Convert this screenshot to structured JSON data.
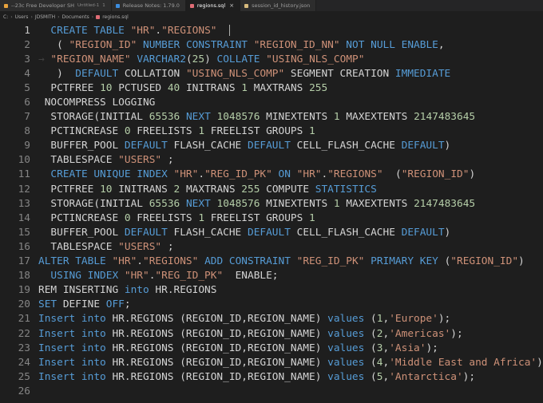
{
  "tabs": [
    {
      "label": "--23c Free Developer SH",
      "sub": "Untitled-1",
      "badge": "1",
      "color": "#e8a33d",
      "active": false
    },
    {
      "label": "Release Notes: 1.79.0",
      "sub": "",
      "badge": "",
      "color": "#3c8dde",
      "active": false
    },
    {
      "label": "regions.sql",
      "sub": "",
      "badge": "",
      "color": "#e06c75",
      "active": true,
      "close": "×"
    },
    {
      "label": "session_id_history.json",
      "sub": "",
      "badge": "",
      "color": "#d7ba7d",
      "active": false
    }
  ],
  "breadcrumb": [
    "C:",
    "Users",
    "JDSMITH",
    "Documents",
    "regions.sql"
  ],
  "lines": [
    {
      "n": "1",
      "t": [
        [
          "ind",
          "  "
        ],
        [
          "kw",
          "CREATE TABLE "
        ],
        [
          "str",
          "\"HR\""
        ],
        [
          "plain",
          "."
        ],
        [
          "str",
          "\"REGIONS\""
        ],
        [
          "plain",
          "  "
        ]
      ]
    },
    {
      "n": "2",
      "t": [
        [
          "ind",
          "   "
        ],
        [
          "plain",
          "( "
        ],
        [
          "str",
          "\"REGION_ID\""
        ],
        [
          "plain",
          " "
        ],
        [
          "kw",
          "NUMBER CONSTRAINT "
        ],
        [
          "str",
          "\"REGION_ID_NN\""
        ],
        [
          "plain",
          " "
        ],
        [
          "kw",
          "NOT NULL ENABLE"
        ],
        [
          "plain",
          ","
        ]
      ]
    },
    {
      "n": "3",
      "t": [
        [
          "ind",
          "→ "
        ],
        [
          "str",
          "\"REGION_NAME\""
        ],
        [
          "plain",
          " "
        ],
        [
          "kw",
          "VARCHAR2"
        ],
        [
          "plain",
          "("
        ],
        [
          "num",
          "25"
        ],
        [
          "plain",
          ") "
        ],
        [
          "kw",
          "COLLATE "
        ],
        [
          "str",
          "\"USING_NLS_COMP\""
        ]
      ]
    },
    {
      "n": "4",
      "t": [
        [
          "ind",
          "   "
        ],
        [
          "plain",
          ")  "
        ],
        [
          "kw",
          "DEFAULT "
        ],
        [
          "plain",
          "COLLATION "
        ],
        [
          "str",
          "\"USING_NLS_COMP\""
        ],
        [
          "plain",
          " SEGMENT CREATION "
        ],
        [
          "kw",
          "IMMEDIATE"
        ]
      ]
    },
    {
      "n": "5",
      "t": [
        [
          "ind",
          "  "
        ],
        [
          "plain",
          "PCTFREE "
        ],
        [
          "num",
          "10"
        ],
        [
          "plain",
          " PCTUSED "
        ],
        [
          "num",
          "40"
        ],
        [
          "plain",
          " INITRANS "
        ],
        [
          "num",
          "1"
        ],
        [
          "plain",
          " MAXTRANS "
        ],
        [
          "num",
          "255"
        ]
      ]
    },
    {
      "n": "6",
      "t": [
        [
          "plain",
          " NOCOMPRESS LOGGING"
        ]
      ]
    },
    {
      "n": "7",
      "t": [
        [
          "ind",
          "  "
        ],
        [
          "plain",
          "STORAGE(INITIAL "
        ],
        [
          "num",
          "65536"
        ],
        [
          "plain",
          " "
        ],
        [
          "kw",
          "NEXT"
        ],
        [
          "plain",
          " "
        ],
        [
          "num",
          "1048576"
        ],
        [
          "plain",
          " MINEXTENTS "
        ],
        [
          "num",
          "1"
        ],
        [
          "plain",
          " MAXEXTENTS "
        ],
        [
          "num",
          "2147483645"
        ]
      ]
    },
    {
      "n": "8",
      "t": [
        [
          "ind",
          "  "
        ],
        [
          "plain",
          "PCTINCREASE "
        ],
        [
          "num",
          "0"
        ],
        [
          "plain",
          " FREELISTS "
        ],
        [
          "num",
          "1"
        ],
        [
          "plain",
          " FREELIST GROUPS "
        ],
        [
          "num",
          "1"
        ]
      ]
    },
    {
      "n": "9",
      "t": [
        [
          "ind",
          "  "
        ],
        [
          "plain",
          "BUFFER_POOL "
        ],
        [
          "kw",
          "DEFAULT"
        ],
        [
          "plain",
          " FLASH_CACHE "
        ],
        [
          "kw",
          "DEFAULT"
        ],
        [
          "plain",
          " CELL_FLASH_CACHE "
        ],
        [
          "kw",
          "DEFAULT"
        ],
        [
          "plain",
          ")"
        ]
      ]
    },
    {
      "n": "10",
      "t": [
        [
          "ind",
          "  "
        ],
        [
          "plain",
          "TABLESPACE "
        ],
        [
          "str",
          "\"USERS\""
        ],
        [
          "plain",
          " ;"
        ]
      ]
    },
    {
      "n": "11",
      "t": [
        [
          "ind",
          "  "
        ],
        [
          "kw",
          "CREATE UNIQUE INDEX "
        ],
        [
          "str",
          "\"HR\""
        ],
        [
          "plain",
          "."
        ],
        [
          "str",
          "\"REG_ID_PK\""
        ],
        [
          "plain",
          " "
        ],
        [
          "kw",
          "ON"
        ],
        [
          "plain",
          " "
        ],
        [
          "str",
          "\"HR\""
        ],
        [
          "plain",
          "."
        ],
        [
          "str",
          "\"REGIONS\""
        ],
        [
          "plain",
          "  ("
        ],
        [
          "str",
          "\"REGION_ID\""
        ],
        [
          "plain",
          ")"
        ]
      ]
    },
    {
      "n": "12",
      "t": [
        [
          "ind",
          "  "
        ],
        [
          "plain",
          "PCTFREE "
        ],
        [
          "num",
          "10"
        ],
        [
          "plain",
          " INITRANS "
        ],
        [
          "num",
          "2"
        ],
        [
          "plain",
          " MAXTRANS "
        ],
        [
          "num",
          "255"
        ],
        [
          "plain",
          " COMPUTE "
        ],
        [
          "kw",
          "STATISTICS"
        ]
      ]
    },
    {
      "n": "13",
      "t": [
        [
          "ind",
          "  "
        ],
        [
          "plain",
          "STORAGE(INITIAL "
        ],
        [
          "num",
          "65536"
        ],
        [
          "plain",
          " "
        ],
        [
          "kw",
          "NEXT"
        ],
        [
          "plain",
          " "
        ],
        [
          "num",
          "1048576"
        ],
        [
          "plain",
          " MINEXTENTS "
        ],
        [
          "num",
          "1"
        ],
        [
          "plain",
          " MAXEXTENTS "
        ],
        [
          "num",
          "2147483645"
        ]
      ]
    },
    {
      "n": "14",
      "t": [
        [
          "ind",
          "  "
        ],
        [
          "plain",
          "PCTINCREASE "
        ],
        [
          "num",
          "0"
        ],
        [
          "plain",
          " FREELISTS "
        ],
        [
          "num",
          "1"
        ],
        [
          "plain",
          " FREELIST GROUPS "
        ],
        [
          "num",
          "1"
        ]
      ]
    },
    {
      "n": "15",
      "t": [
        [
          "ind",
          "  "
        ],
        [
          "plain",
          "BUFFER_POOL "
        ],
        [
          "kw",
          "DEFAULT"
        ],
        [
          "plain",
          " FLASH_CACHE "
        ],
        [
          "kw",
          "DEFAULT"
        ],
        [
          "plain",
          " CELL_FLASH_CACHE "
        ],
        [
          "kw",
          "DEFAULT"
        ],
        [
          "plain",
          ")"
        ]
      ]
    },
    {
      "n": "16",
      "t": [
        [
          "ind",
          "  "
        ],
        [
          "plain",
          "TABLESPACE "
        ],
        [
          "str",
          "\"USERS\""
        ],
        [
          "plain",
          " ;"
        ]
      ]
    },
    {
      "n": "17",
      "t": [
        [
          "kw",
          "ALTER TABLE "
        ],
        [
          "str",
          "\"HR\""
        ],
        [
          "plain",
          "."
        ],
        [
          "str",
          "\"REGIONS\""
        ],
        [
          "plain",
          " "
        ],
        [
          "kw",
          "ADD CONSTRAINT "
        ],
        [
          "str",
          "\"REG_ID_PK\""
        ],
        [
          "plain",
          " "
        ],
        [
          "kw",
          "PRIMARY KEY "
        ],
        [
          "plain",
          "("
        ],
        [
          "str",
          "\"REGION_ID\""
        ],
        [
          "plain",
          ")"
        ]
      ]
    },
    {
      "n": "18",
      "t": [
        [
          "ind",
          "  "
        ],
        [
          "kw",
          "USING INDEX "
        ],
        [
          "str",
          "\"HR\""
        ],
        [
          "plain",
          "."
        ],
        [
          "str",
          "\"REG_ID_PK\""
        ],
        [
          "plain",
          "  ENABLE;"
        ]
      ]
    },
    {
      "n": "19",
      "t": [
        [
          "plain",
          "REM INSERTING "
        ],
        [
          "kw",
          "into"
        ],
        [
          "plain",
          " HR.REGIONS"
        ]
      ]
    },
    {
      "n": "20",
      "t": [
        [
          "kw",
          "SET"
        ],
        [
          "plain",
          " DEFINE "
        ],
        [
          "kw",
          "OFF"
        ],
        [
          "plain",
          ";"
        ]
      ]
    },
    {
      "n": "21",
      "t": [
        [
          "kw",
          "Insert into"
        ],
        [
          "plain",
          " HR.REGIONS (REGION_ID,REGION_NAME) "
        ],
        [
          "kw",
          "values"
        ],
        [
          "plain",
          " ("
        ],
        [
          "num",
          "1"
        ],
        [
          "plain",
          ","
        ],
        [
          "str",
          "'Europe'"
        ],
        [
          "plain",
          ");"
        ]
      ]
    },
    {
      "n": "22",
      "t": [
        [
          "kw",
          "Insert into"
        ],
        [
          "plain",
          " HR.REGIONS (REGION_ID,REGION_NAME) "
        ],
        [
          "kw",
          "values"
        ],
        [
          "plain",
          " ("
        ],
        [
          "num",
          "2"
        ],
        [
          "plain",
          ","
        ],
        [
          "str",
          "'Americas'"
        ],
        [
          "plain",
          ");"
        ]
      ]
    },
    {
      "n": "23",
      "t": [
        [
          "kw",
          "Insert into"
        ],
        [
          "plain",
          " HR.REGIONS (REGION_ID,REGION_NAME) "
        ],
        [
          "kw",
          "values"
        ],
        [
          "plain",
          " ("
        ],
        [
          "num",
          "3"
        ],
        [
          "plain",
          ","
        ],
        [
          "str",
          "'Asia'"
        ],
        [
          "plain",
          ");"
        ]
      ]
    },
    {
      "n": "24",
      "t": [
        [
          "kw",
          "Insert into"
        ],
        [
          "plain",
          " HR.REGIONS (REGION_ID,REGION_NAME) "
        ],
        [
          "kw",
          "values"
        ],
        [
          "plain",
          " ("
        ],
        [
          "num",
          "4"
        ],
        [
          "plain",
          ","
        ],
        [
          "str",
          "'Middle East and Africa'"
        ],
        [
          "plain",
          ");"
        ]
      ]
    },
    {
      "n": "25",
      "t": [
        [
          "kw",
          "Insert into"
        ],
        [
          "plain",
          " HR.REGIONS (REGION_ID,REGION_NAME) "
        ],
        [
          "kw",
          "values"
        ],
        [
          "plain",
          " ("
        ],
        [
          "num",
          "5"
        ],
        [
          "plain",
          ","
        ],
        [
          "str",
          "'Antarctica'"
        ],
        [
          "plain",
          ");"
        ]
      ]
    },
    {
      "n": "26",
      "t": []
    }
  ]
}
